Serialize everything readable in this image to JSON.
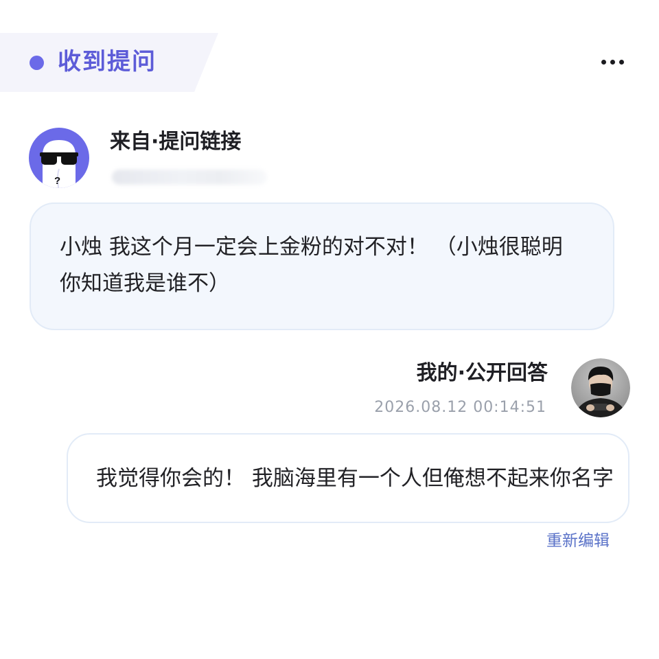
{
  "header": {
    "title": "收到提问",
    "more_icon": "more-horizontal-icon",
    "accent_color": "#6b6ae8"
  },
  "question": {
    "avatar_icon": "anonymous-sunglasses-avatar",
    "source_label": "来自·提问链接",
    "text": "小烛 我这个月一定会上金粉的对不对！ （小烛很聪明 你知道我是谁不）"
  },
  "answer": {
    "label": "我的·公开回答",
    "timestamp": "2026.08.12 00:14:51",
    "avatar": "user-avatar",
    "text": "我觉得你会的！ 我脑海里有一个人但俺想不起来你名字",
    "reedit_label": "重新编辑"
  }
}
